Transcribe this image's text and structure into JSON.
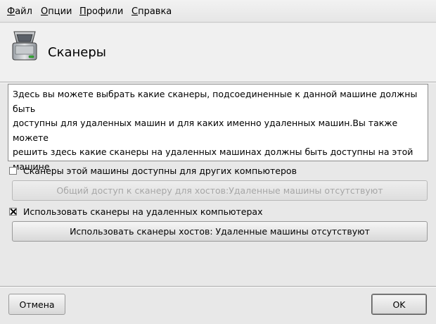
{
  "menu": {
    "items": [
      {
        "first": "Ф",
        "rest": "айл"
      },
      {
        "first": "О",
        "rest": "пции"
      },
      {
        "first": "П",
        "rest": "рофили"
      },
      {
        "first": "С",
        "rest": "правка"
      }
    ]
  },
  "header": {
    "icon": "scanner-icon",
    "title": "Сканеры"
  },
  "description": {
    "line1": "Здесь вы можете выбрать какие сканеры, подсоединенные к данной машине должны быть",
    "line2": "доступны для удаленных машин и для каких именно удаленных машин.Вы также можете",
    "line3": "решить здесь какие сканеры на удаленных машинах должны быть доступны на этой машине"
  },
  "options": {
    "share_local": {
      "checked": false,
      "label": "Сканеры этой машины доступны для других компьютеров",
      "button_label": "Общий доступ к сканеру для хостов:Удаленные машины отсутствуют",
      "button_enabled": false
    },
    "use_remote": {
      "checked": true,
      "label": "Использовать сканеры на удаленных компьютерах",
      "button_label": "Использовать сканеры хостов: Удаленные машины отсутствуют",
      "button_enabled": true
    }
  },
  "footer": {
    "cancel_label": "Отмена",
    "ok_label": "OK"
  }
}
